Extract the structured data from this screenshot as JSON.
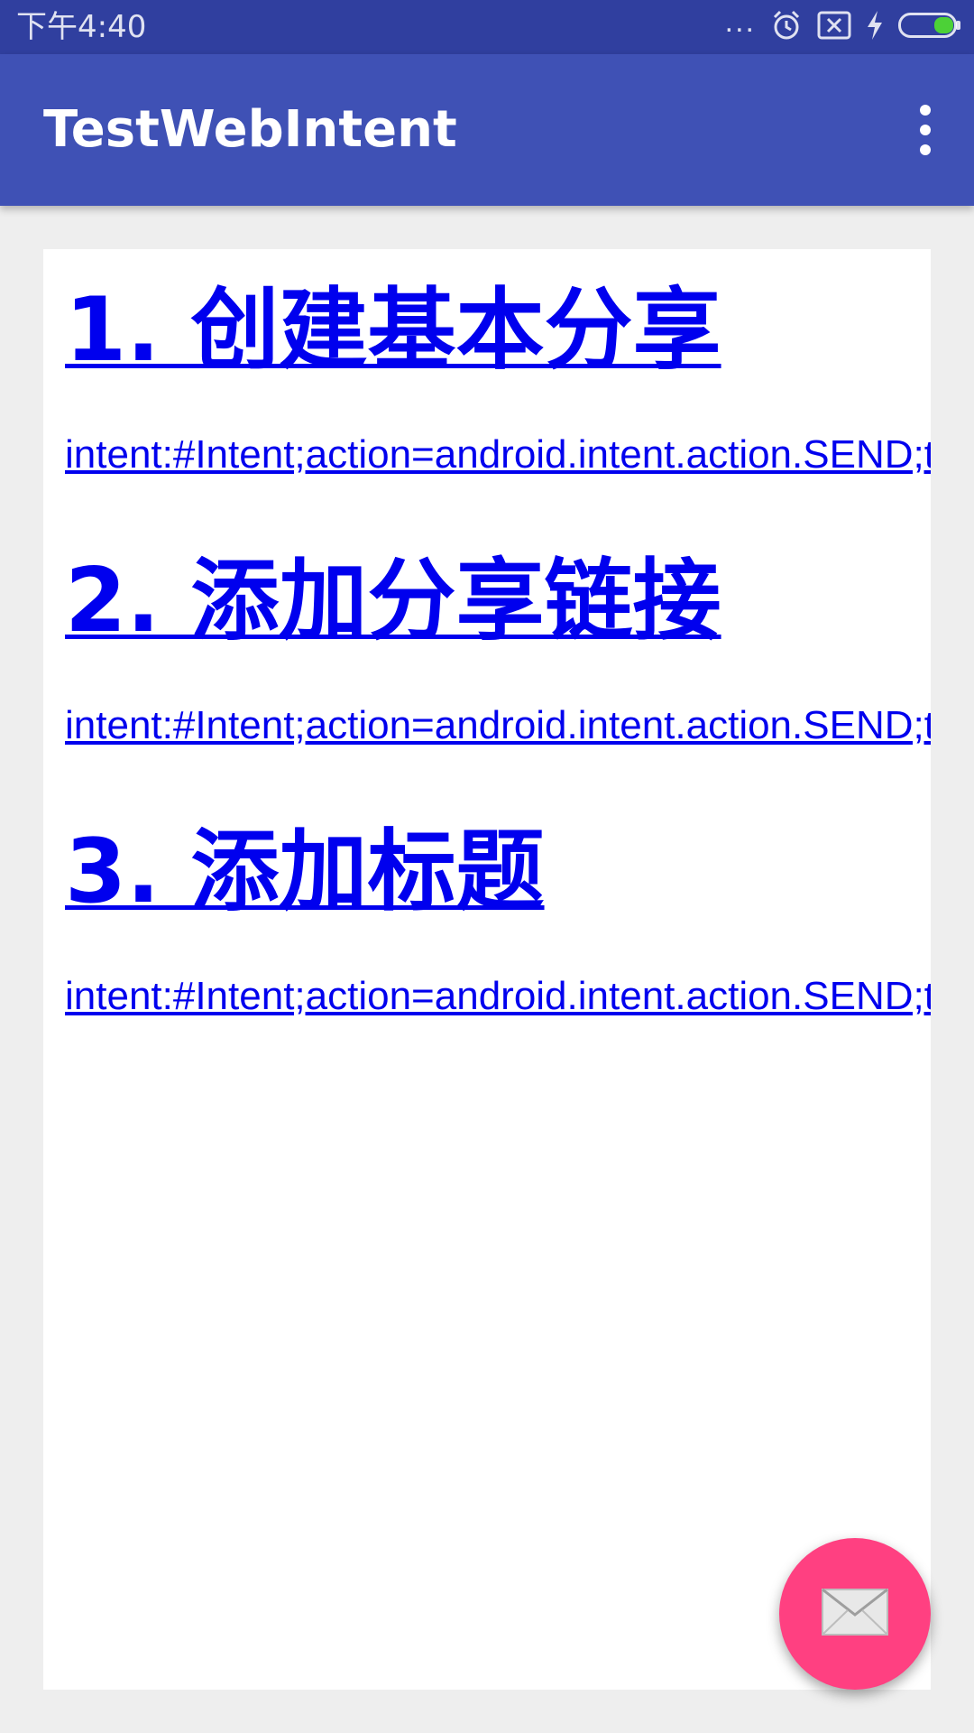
{
  "status_bar": {
    "time": "下午4:40",
    "icons": [
      "more-dots-icon",
      "alarm-icon",
      "no-sim-icon",
      "charging-icon",
      "battery-icon"
    ],
    "more_dots": "..."
  },
  "app_bar": {
    "title": "TestWebIntent",
    "overflow_icon": "more-vert-icon"
  },
  "content": {
    "sections": [
      {
        "heading": "1. 创建基本分享",
        "link": "intent:#Intent;action=android.intent.action.SEND;type=text/plain;end"
      },
      {
        "heading": "2. 添加分享链接",
        "link": "intent:#Intent;action=android.intent.action.SEND;type=text/plain;S.android.intent.extra.TEXT=;end"
      },
      {
        "heading": "3. 添加标题",
        "link": "intent:#Intent;action=android.intent.action.SEND;type=text/plain;S.android.intent.extra.SUBJECT=;end"
      }
    ]
  },
  "fab": {
    "icon": "mail-icon"
  },
  "colors": {
    "status_bar": "#303f9f",
    "app_bar": "#3f51b5",
    "link": "#0000ee",
    "fab": "#ff4081",
    "background": "#eeeeee"
  }
}
